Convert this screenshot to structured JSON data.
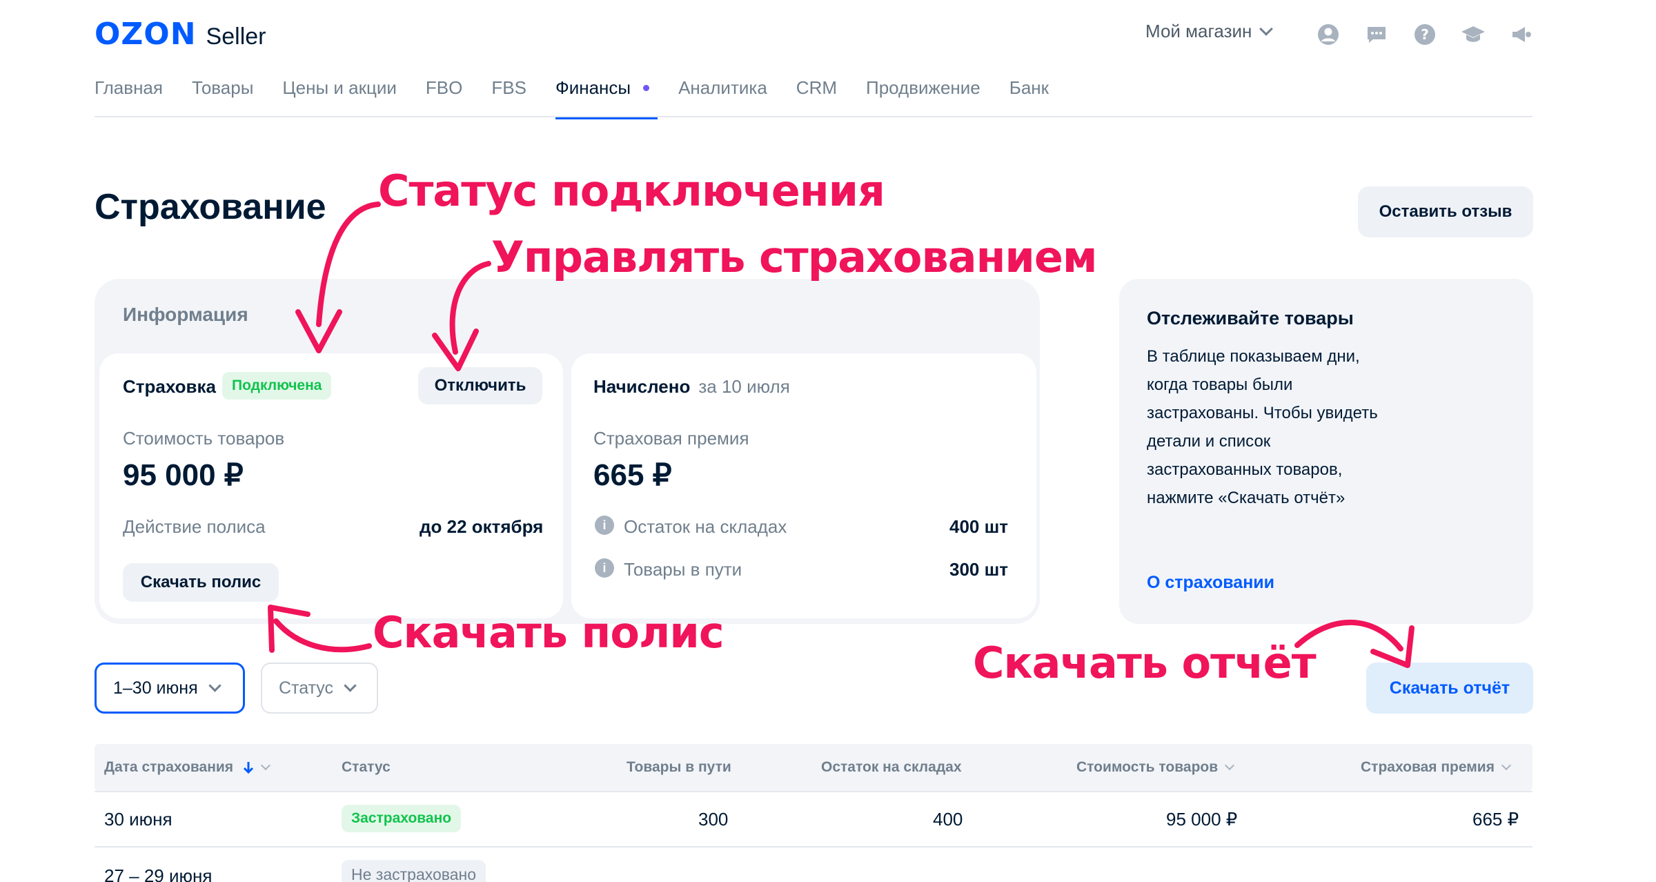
{
  "header": {
    "logo_ozon": "OZON",
    "logo_seller": "Seller",
    "store_label": "Мой магазин",
    "icons": [
      "profile-icon",
      "chat-icon",
      "help-icon",
      "education-icon",
      "announcement-icon"
    ]
  },
  "nav": {
    "items": [
      {
        "label": "Главная"
      },
      {
        "label": "Товары"
      },
      {
        "label": "Цены и акции"
      },
      {
        "label": "FBO"
      },
      {
        "label": "FBS"
      },
      {
        "label": "Финансы",
        "active": true
      },
      {
        "label": "Аналитика"
      },
      {
        "label": "CRM"
      },
      {
        "label": "Продвижение"
      },
      {
        "label": "Банк"
      }
    ]
  },
  "page": {
    "title": "Страхование",
    "feedback_button": "Оставить отзыв"
  },
  "info": {
    "title": "Информация",
    "insurance": {
      "label": "Страховка",
      "status": "Подключена",
      "disable_button": "Отключить",
      "cost_label": "Стоимость товаров",
      "cost_value": "95 000 ₽",
      "policy_label": "Действие полиса",
      "policy_value": "до 22 октября",
      "download_button": "Скачать полис"
    },
    "accrued": {
      "label": "Начислено",
      "period": "за 10 июля",
      "premium_label": "Страховая премия",
      "premium_value": "665 ₽",
      "warehouse_label": "Остаток на складах",
      "warehouse_value": "400 шт",
      "transit_label": "Товары в пути",
      "transit_value": "300 шт"
    }
  },
  "side": {
    "title": "Отслеживайте товары",
    "lines": [
      "В таблице показываем дни,",
      "когда товары были",
      "застрахованы. Чтобы увидеть",
      "детали и список",
      "застрахованных товаров,",
      "нажмите «Скачать отчёт»"
    ],
    "link": "О страховании"
  },
  "filters": {
    "date": "1–30 июня",
    "status": "Статус",
    "report_button": "Скачать отчёт"
  },
  "table": {
    "headers": {
      "date": "Дата страхования",
      "status": "Статус",
      "transit": "Товары в пути",
      "warehouse": "Остаток на складах",
      "cost": "Стоимость товаров",
      "premium": "Страховая премия"
    },
    "rows": [
      {
        "date": "30 июня",
        "status": "Застраховано",
        "transit": "300",
        "warehouse": "400",
        "cost": "95 000 ₽",
        "premium": "665 ₽"
      },
      {
        "date": "27 – 29 июня",
        "status": "Не застраховано"
      }
    ]
  },
  "annotations": {
    "status": "Статус подключения",
    "manage": "Управлять страхованием",
    "download_policy": "Скачать полис",
    "download_report": "Скачать отчёт",
    "color": "#f0145a"
  }
}
